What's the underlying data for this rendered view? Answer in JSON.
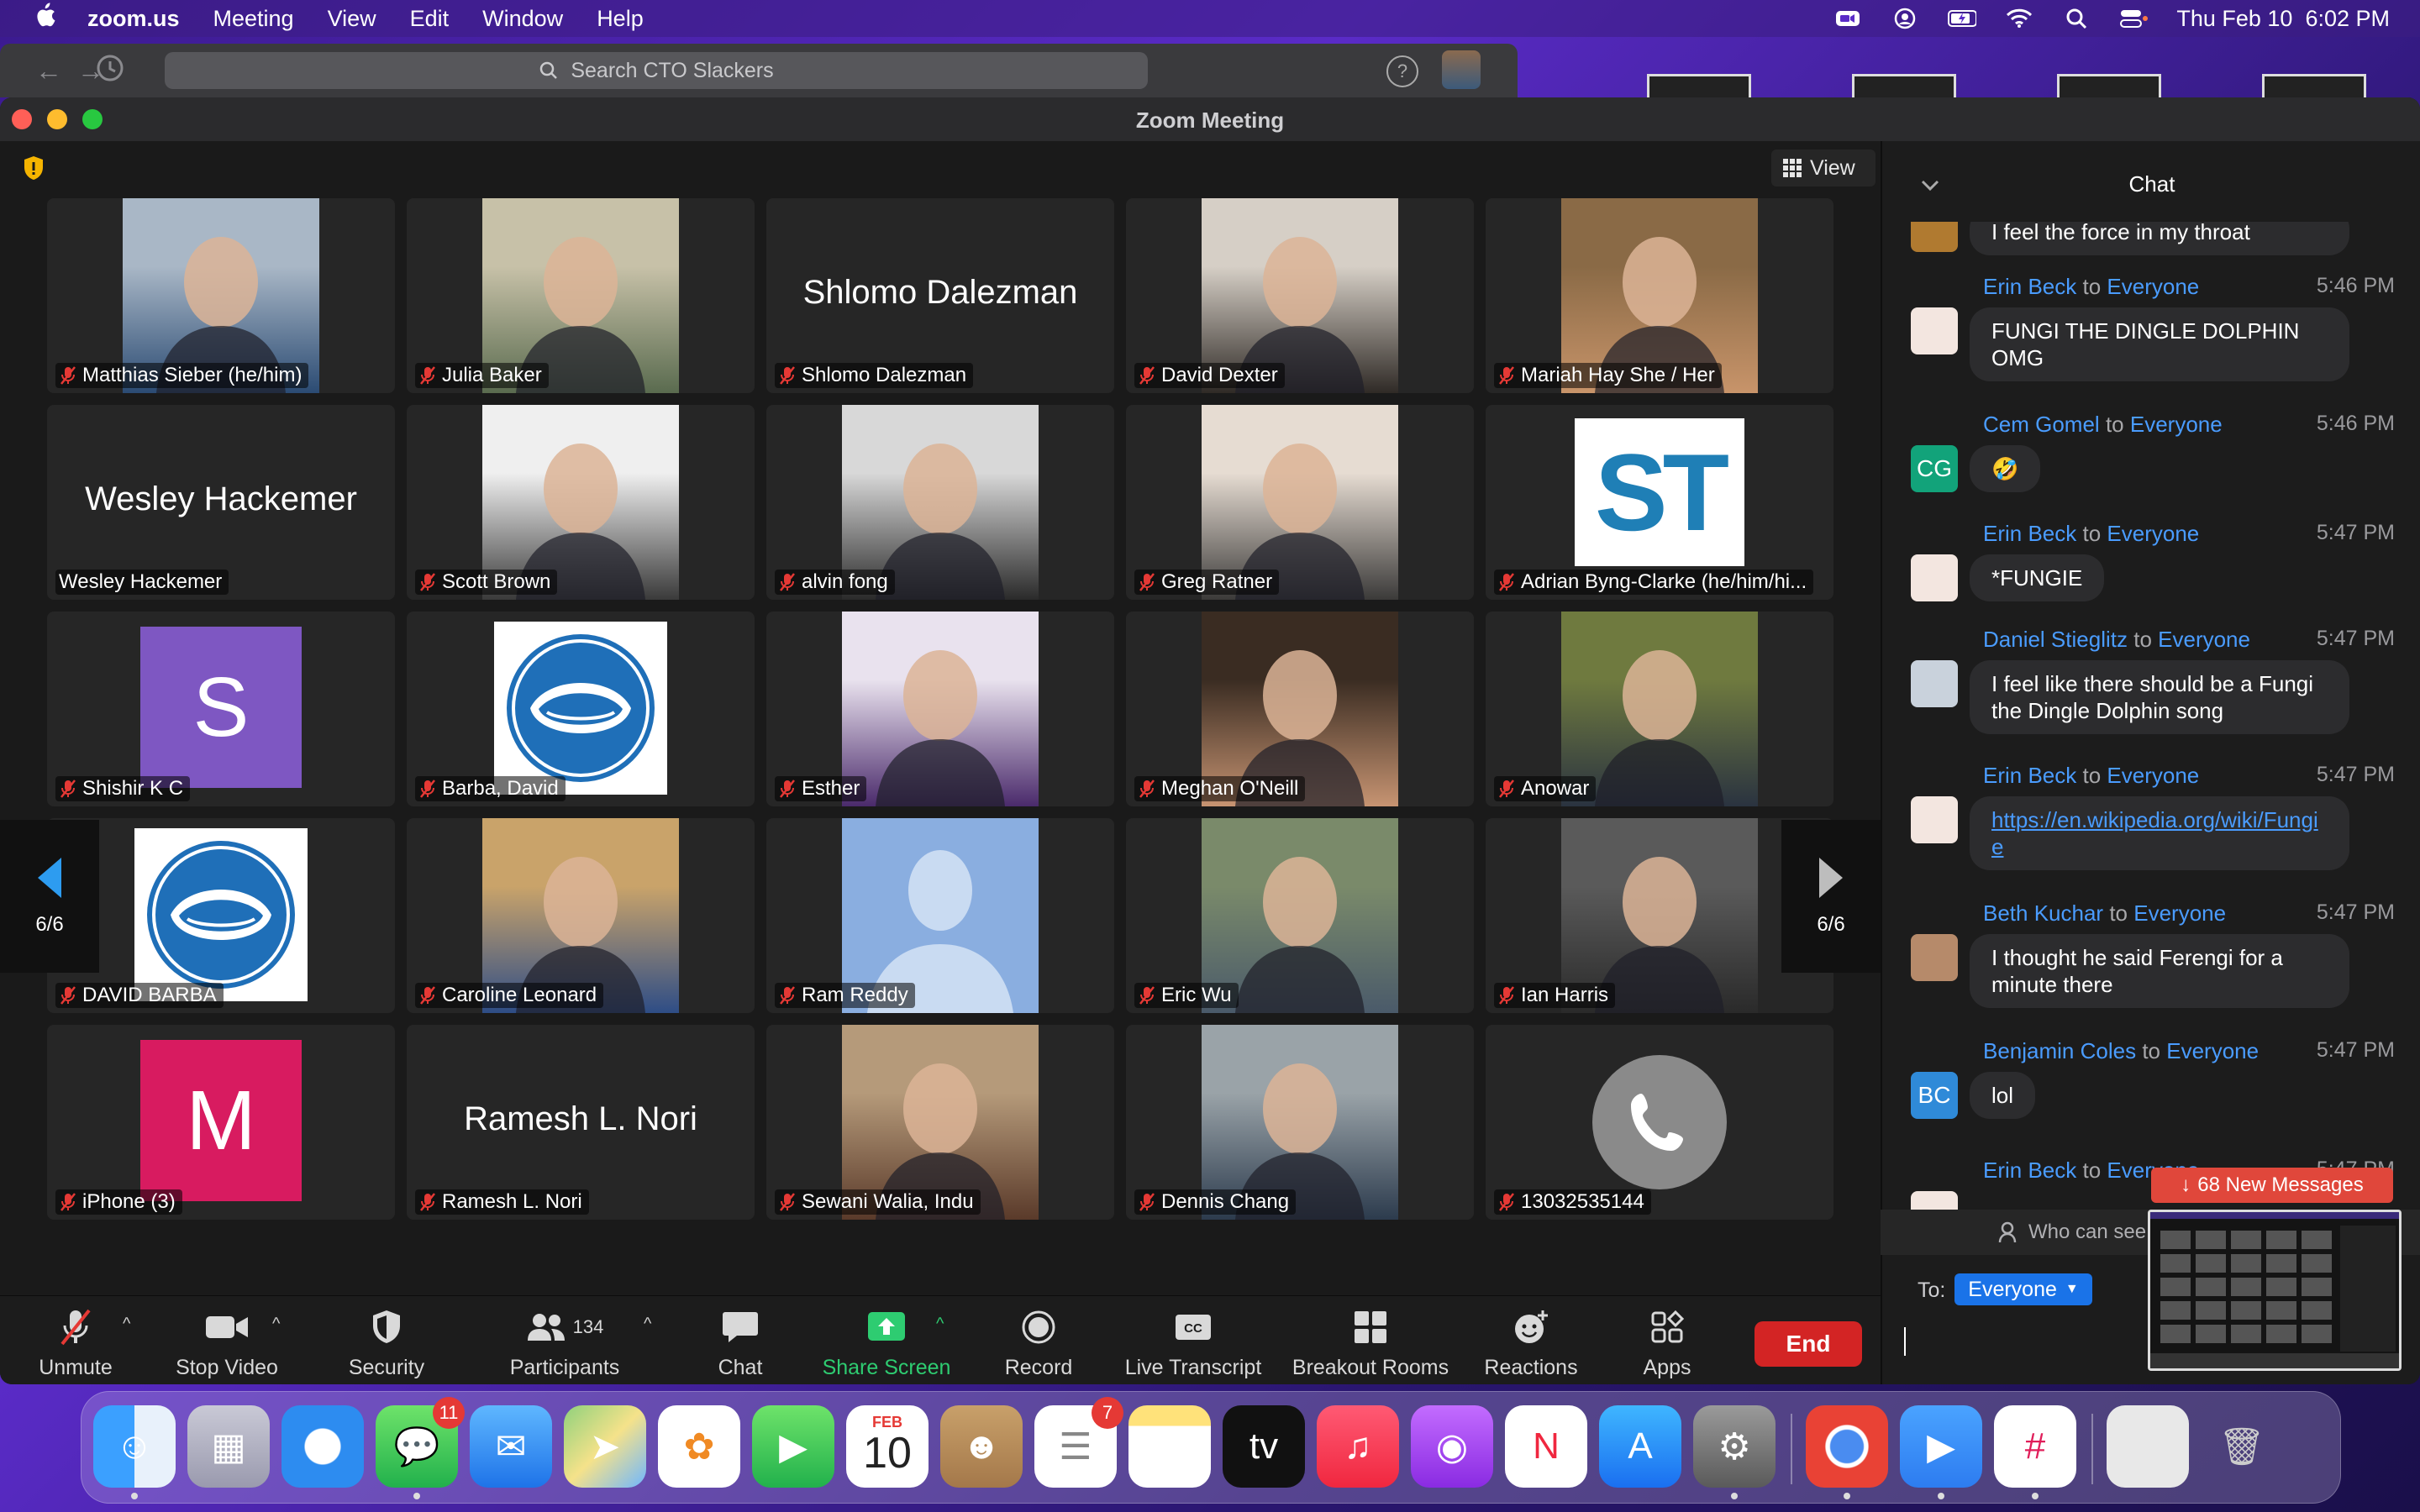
{
  "menubar": {
    "app_name": "zoom.us",
    "items": [
      "Meeting",
      "View",
      "Edit",
      "Window",
      "Help"
    ],
    "clock": "Thu Feb 10  6:02 PM"
  },
  "background_window": {
    "search_placeholder": "Search CTO Slackers",
    "help_label": "?"
  },
  "window": {
    "title": "Zoom Meeting",
    "view_label": "View"
  },
  "gallery": {
    "page_indicator_left": "6/6",
    "page_indicator_right": "6/6",
    "tiles": [
      {
        "name": "Matthias Sieber (he/him)",
        "muted": true,
        "kind": "photo",
        "colors": [
          "#a9b7c6",
          "#2b4b73"
        ]
      },
      {
        "name": "Julia Baker",
        "muted": true,
        "kind": "photo",
        "colors": [
          "#c7c1a8",
          "#5a6b4f"
        ]
      },
      {
        "name": "Shlomo Dalezman",
        "muted": true,
        "kind": "text",
        "big": "Shlomo Dalezman"
      },
      {
        "name": "David Dexter",
        "muted": true,
        "kind": "photo",
        "colors": [
          "#d6cfc6",
          "#2f2a26"
        ]
      },
      {
        "name": "Mariah Hay She / Her",
        "muted": true,
        "kind": "photo",
        "colors": [
          "#8a6a46",
          "#c8946a"
        ]
      },
      {
        "name": "Wesley Hackemer",
        "muted": false,
        "kind": "text",
        "big": "Wesley Hackemer"
      },
      {
        "name": "Scott Brown",
        "muted": true,
        "kind": "photo",
        "colors": [
          "#efefef",
          "#3a3a3a"
        ]
      },
      {
        "name": "alvin fong",
        "muted": true,
        "kind": "photo",
        "colors": [
          "#d8d8d8",
          "#2a2a2a"
        ]
      },
      {
        "name": "Greg Ratner",
        "muted": true,
        "kind": "photo",
        "colors": [
          "#e6dcd2",
          "#3b3a39"
        ]
      },
      {
        "name": "Adrian Byng-Clarke (he/him/hi...",
        "muted": true,
        "kind": "logo",
        "logo": "ST"
      },
      {
        "name": "Shishir K C",
        "muted": true,
        "kind": "letter",
        "letter": "S",
        "color": "#7e57c2"
      },
      {
        "name": "Barba, David",
        "muted": true,
        "kind": "hands"
      },
      {
        "name": "Esther",
        "muted": true,
        "kind": "photo",
        "colors": [
          "#e9e2ee",
          "#4a2a6b"
        ]
      },
      {
        "name": "Meghan O'Neill",
        "muted": true,
        "kind": "photo",
        "colors": [
          "#3a2c22",
          "#c79472"
        ]
      },
      {
        "name": "Anowar",
        "muted": true,
        "kind": "photo",
        "colors": [
          "#6f7a3f",
          "#2a3340"
        ]
      },
      {
        "name": "DAVID BARBA",
        "muted": true,
        "kind": "hands"
      },
      {
        "name": "Caroline Leonard",
        "muted": true,
        "kind": "photo",
        "colors": [
          "#c9a36a",
          "#2e4d86"
        ]
      },
      {
        "name": "Ram Reddy",
        "muted": true,
        "kind": "silhouette"
      },
      {
        "name": "Eric Wu",
        "muted": true,
        "kind": "photo",
        "colors": [
          "#7a8a6a",
          "#4a5a6a"
        ]
      },
      {
        "name": "Ian Harris",
        "muted": true,
        "kind": "photo",
        "colors": [
          "#5a5a5a",
          "#2a2a2a"
        ]
      },
      {
        "name": "iPhone (3)",
        "muted": true,
        "kind": "letter",
        "letter": "M",
        "color": "#d81b60"
      },
      {
        "name": "Ramesh L. Nori",
        "muted": true,
        "kind": "text",
        "big": "Ramesh L. Nori"
      },
      {
        "name": "Sewani Walia, Indu",
        "muted": true,
        "kind": "photo",
        "colors": [
          "#b59a7a",
          "#5a3a2a"
        ]
      },
      {
        "name": "Dennis Chang",
        "muted": true,
        "kind": "photo",
        "colors": [
          "#9aa3a8",
          "#2c3b4d"
        ]
      },
      {
        "name": "13032535144",
        "muted": true,
        "kind": "phone"
      }
    ]
  },
  "toolbar": {
    "unmute": "Unmute",
    "stop_video": "Stop Video",
    "security": "Security",
    "participants": "Participants",
    "participants_count": "134",
    "chat": "Chat",
    "share_screen": "Share Screen",
    "record": "Record",
    "live_transcript": "Live Transcript",
    "breakout_rooms": "Breakout Rooms",
    "reactions": "Reactions",
    "apps": "Apps",
    "end": "End"
  },
  "chat": {
    "title": "Chat",
    "to_word": "to",
    "messages": [
      {
        "from": "",
        "to": "",
        "time": "",
        "text": "I feel the force in my throat",
        "avatar": "",
        "avatar_color": "#b07a30"
      },
      {
        "from": "Erin Beck",
        "to": "Everyone",
        "time": "5:46 PM",
        "text": "FUNGI THE DINGLE DOLPHIN OMG",
        "avatar": "",
        "avatar_color": "#f3e6e0"
      },
      {
        "from": "Cem Gomel",
        "to": "Everyone",
        "time": "5:46 PM",
        "text": "🤣",
        "avatar": "CG",
        "avatar_color": "#12a37a"
      },
      {
        "from": "Erin Beck",
        "to": "Everyone",
        "time": "5:47 PM",
        "text": "*FUNGIE",
        "avatar": "",
        "avatar_color": "#f3e6e0"
      },
      {
        "from": "Daniel Stieglitz",
        "to": "Everyone",
        "time": "5:47 PM",
        "text": "I feel like there should be a Fungi the Dingle Dolphin song",
        "avatar": "",
        "avatar_color": "#c9d2dc"
      },
      {
        "from": "Erin Beck",
        "to": "Everyone",
        "time": "5:47 PM",
        "text": "https://en.wikipedia.org/wiki/Fungie",
        "avatar": "",
        "avatar_color": "#f3e6e0",
        "link": true
      },
      {
        "from": "Beth Kuchar",
        "to": "Everyone",
        "time": "5:47 PM",
        "text": "I thought he said Ferengi for a minute there",
        "avatar": "",
        "avatar_color": "#b68a6a"
      },
      {
        "from": "Benjamin Coles",
        "to": "Everyone",
        "time": "5:47 PM",
        "text": "lol",
        "avatar": "BC",
        "avatar_color": "#2f8ad8"
      },
      {
        "from": "Erin Beck",
        "to": "Everyone",
        "time": "5:47 PM",
        "text": "",
        "avatar": "",
        "avatar_color": "#f3e6e0"
      }
    ],
    "new_messages": "68 New Messages",
    "who_can_see": "Who can see",
    "to_label": "To:",
    "to_value": "Everyone"
  },
  "dock": {
    "messages_badge": "11",
    "reminders_badge": "7",
    "calendar_month": "FEB",
    "calendar_day": "10"
  }
}
